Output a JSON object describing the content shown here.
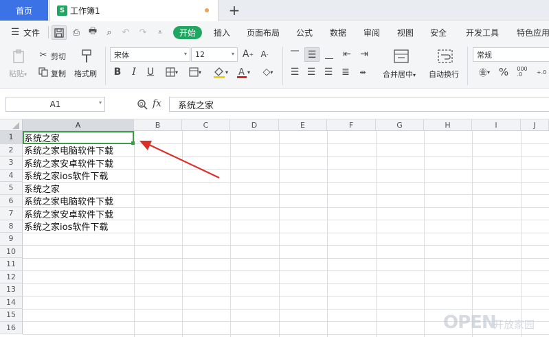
{
  "tabs": {
    "home": "首页",
    "workbook_badge": "S",
    "workbook": "工作簿1",
    "add": "+"
  },
  "menu": {
    "file": "文件",
    "items": [
      "开始",
      "插入",
      "页面布局",
      "公式",
      "数据",
      "审阅",
      "视图",
      "安全",
      "开发工具",
      "特色应用"
    ]
  },
  "ribbon": {
    "paste": "粘贴",
    "cut": "剪切",
    "copy": "复制",
    "format_painter": "格式刷",
    "font_name": "宋体",
    "font_size": "12",
    "merge_center": "合并居中",
    "wrap_text": "自动换行",
    "number_format": "常规",
    "percent": "%",
    "dropdown_marker": "▾"
  },
  "formula_bar": {
    "name_box": "A1",
    "fx_label": "fx",
    "content": "系统之家"
  },
  "columns": [
    "A",
    "B",
    "C",
    "D",
    "E",
    "F",
    "G",
    "H",
    "I",
    "J"
  ],
  "rows": [
    "1",
    "2",
    "3",
    "4",
    "5",
    "6",
    "7",
    "8",
    "9",
    "10",
    "11",
    "12",
    "13",
    "14",
    "15",
    "16"
  ],
  "cells_A": [
    "系统之家",
    "系统之家电脑软件下载",
    "系统之家安卓软件下载",
    "系统之家ios软件下载",
    "系统之家",
    "系统之家电脑软件下载",
    "系统之家安卓软件下载",
    "系统之家ios软件下载"
  ],
  "watermark": {
    "main": "OPEN",
    "sub": "开放家园"
  },
  "colors": {
    "accent": "#1fa660",
    "home_tab": "#3b73e6",
    "selection": "#3d9a45",
    "arrow": "#d9302a"
  }
}
